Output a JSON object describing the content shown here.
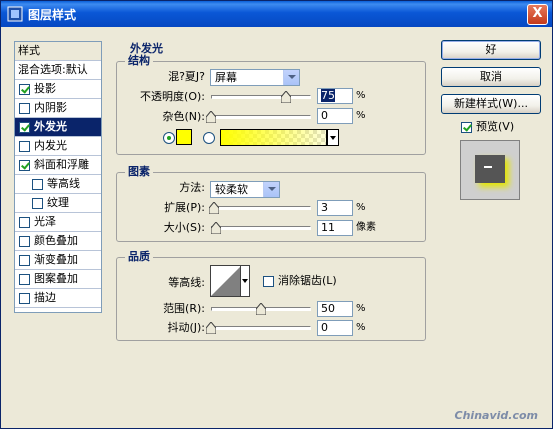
{
  "window": {
    "title": "图层样式",
    "close_glyph": "X"
  },
  "styles_list": {
    "header": "样式",
    "blend_options": "混合选项:默认",
    "items": [
      {
        "label": "投影",
        "checked": true,
        "selected": false,
        "indent": false
      },
      {
        "label": "内阴影",
        "checked": false,
        "selected": false,
        "indent": false
      },
      {
        "label": "外发光",
        "checked": true,
        "selected": true,
        "indent": false
      },
      {
        "label": "内发光",
        "checked": false,
        "selected": false,
        "indent": false
      },
      {
        "label": "斜面和浮雕",
        "checked": true,
        "selected": false,
        "indent": false
      },
      {
        "label": "等高线",
        "checked": false,
        "selected": false,
        "indent": true
      },
      {
        "label": "纹理",
        "checked": false,
        "selected": false,
        "indent": true
      },
      {
        "label": "光泽",
        "checked": false,
        "selected": false,
        "indent": false
      },
      {
        "label": "颜色叠加",
        "checked": false,
        "selected": false,
        "indent": false
      },
      {
        "label": "渐变叠加",
        "checked": false,
        "selected": false,
        "indent": false
      },
      {
        "label": "图案叠加",
        "checked": false,
        "selected": false,
        "indent": false
      },
      {
        "label": "描边",
        "checked": false,
        "selected": false,
        "indent": false
      }
    ]
  },
  "outer_glow": {
    "heading": "外发光",
    "structure": {
      "title": "结构",
      "blend_mode_label": "混?夏J?",
      "blend_mode_value": "屏幕",
      "opacity_label": "不透明度(O):",
      "opacity_value": "75",
      "opacity_unit": "%",
      "opacity_fraction": 0.75,
      "noise_label": "杂色(N):",
      "noise_value": "0",
      "noise_unit": "%",
      "noise_fraction": 0,
      "glow_color": "#ffff00",
      "gradient_color": "#ffff00"
    },
    "elements": {
      "title": "图素",
      "method_label": "方法:",
      "method_value": "较柔软",
      "spread_label": "扩展(P):",
      "spread_value": "3",
      "spread_unit": "%",
      "spread_fraction": 0.03,
      "size_label": "大小(S):",
      "size_value": "11",
      "size_unit": "像素",
      "size_fraction": 0.045
    },
    "quality": {
      "title": "品质",
      "contour_label": "等高线:",
      "antialias_label": "消除锯齿(L)",
      "antialias_checked": false,
      "range_label": "范围(R):",
      "range_value": "50",
      "range_unit": "%",
      "range_fraction": 0.5,
      "jitter_label": "抖动(J):",
      "jitter_value": "0",
      "jitter_unit": "%",
      "jitter_fraction": 0
    }
  },
  "buttons": {
    "ok": "好",
    "cancel": "取消",
    "new_style": "新建样式(W)...",
    "preview": "预览(V)",
    "preview_checked": true
  },
  "watermark": "Chinavid.com"
}
